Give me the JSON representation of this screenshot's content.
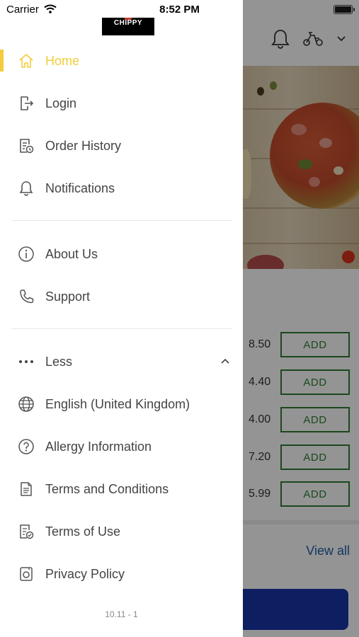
{
  "status": {
    "carrier": "Carrier",
    "time": "8:52 PM"
  },
  "drawer": {
    "logo_text": "CHIPPY",
    "primary": [
      {
        "label": "Home",
        "icon": "home-icon",
        "active": true
      },
      {
        "label": "Login",
        "icon": "login-icon"
      },
      {
        "label": "Order History",
        "icon": "order-history-icon"
      },
      {
        "label": "Notifications",
        "icon": "bell-icon"
      }
    ],
    "secondary": [
      {
        "label": "About Us",
        "icon": "info-icon"
      },
      {
        "label": "Support",
        "icon": "phone-icon"
      }
    ],
    "more_toggle": {
      "label": "Less",
      "icon": "more-dots-icon",
      "state_icon": "chevron-up-icon"
    },
    "extra": [
      {
        "label": "English (United Kingdom)",
        "icon": "globe-icon"
      },
      {
        "label": "Allergy Information",
        "icon": "question-circle-icon"
      },
      {
        "label": "Terms and Conditions",
        "icon": "document-icon"
      },
      {
        "label": "Terms of Use",
        "icon": "document-check-icon"
      },
      {
        "label": "Privacy Policy",
        "icon": "privacy-icon"
      }
    ],
    "version": "10.11 - 1",
    "accent_color": "#f2cc3d"
  },
  "background": {
    "header_icons": [
      "bell-icon",
      "scooter-icon",
      "chevron-down-icon"
    ],
    "products": [
      {
        "price": "8.50",
        "button": "ADD"
      },
      {
        "price": "4.40",
        "button": "ADD"
      },
      {
        "price": "4.00",
        "button": "ADD"
      },
      {
        "price": "7.20",
        "button": "ADD"
      },
      {
        "price": "5.99",
        "button": "ADD"
      }
    ],
    "view_all": "View all",
    "button_color": "#2e7d32",
    "cta_color": "#1835a8"
  }
}
